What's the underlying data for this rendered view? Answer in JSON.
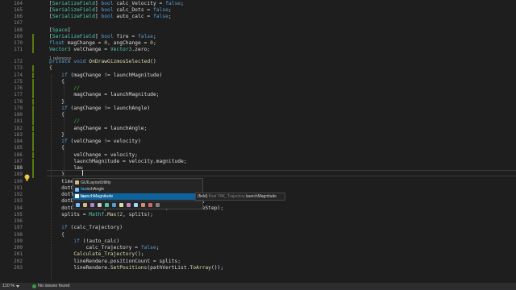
{
  "editor": {
    "lines": [
      {
        "num": "164",
        "mod": false,
        "tokens": [
          [
            "c",
            "p",
            ""
          ],
          [
            "t",
            "p",
            "["
          ],
          [
            "t",
            "t",
            "SerializeField"
          ],
          [
            "t",
            "p",
            "] "
          ],
          [
            "t",
            "k",
            "bool"
          ],
          [
            "t",
            "p",
            " calc_Velocity = "
          ],
          [
            "t",
            "k",
            "false"
          ],
          [
            "t",
            "p",
            ";"
          ]
        ]
      },
      {
        "num": "165",
        "mod": false,
        "tokens": [
          [
            "t",
            "p",
            "["
          ],
          [
            "t",
            "t",
            "SerializeField"
          ],
          [
            "t",
            "p",
            "] "
          ],
          [
            "t",
            "k",
            "bool"
          ],
          [
            "t",
            "p",
            " calc_Dots = "
          ],
          [
            "t",
            "k",
            "false"
          ],
          [
            "t",
            "p",
            ";"
          ]
        ]
      },
      {
        "num": "166",
        "mod": false,
        "tokens": [
          [
            "t",
            "p",
            "["
          ],
          [
            "t",
            "t",
            "SerializeField"
          ],
          [
            "t",
            "p",
            "] "
          ],
          [
            "t",
            "k",
            "bool"
          ],
          [
            "t",
            "p",
            " auto_calc = "
          ],
          [
            "t",
            "k",
            "false"
          ],
          [
            "t",
            "p",
            ";"
          ]
        ]
      },
      {
        "num": "167",
        "mod": false,
        "tokens": []
      },
      {
        "num": "168",
        "mod": false,
        "tokens": [
          [
            "t",
            "p",
            "["
          ],
          [
            "t",
            "t",
            "Space"
          ],
          [
            "t",
            "p",
            "]"
          ]
        ]
      },
      {
        "num": "169",
        "mod": true,
        "tokens": [
          [
            "t",
            "p",
            "["
          ],
          [
            "t",
            "t",
            "SerializeField"
          ],
          [
            "t",
            "p",
            "] "
          ],
          [
            "t",
            "k",
            "bool"
          ],
          [
            "t",
            "p",
            " fire = "
          ],
          [
            "t",
            "k",
            "false"
          ],
          [
            "t",
            "p",
            ";"
          ]
        ]
      },
      {
        "num": "170",
        "mod": true,
        "tokens": [
          [
            "t",
            "k",
            "float"
          ],
          [
            "t",
            "p",
            " magChange = "
          ],
          [
            "t",
            "n",
            "0"
          ],
          [
            "t",
            "p",
            ", angChange = "
          ],
          [
            "t",
            "n",
            "0"
          ],
          [
            "t",
            "p",
            ";"
          ]
        ]
      },
      {
        "num": "171",
        "mod": true,
        "tokens": [
          [
            "t",
            "t",
            "Vector3"
          ],
          [
            "t",
            "p",
            " velChange = "
          ],
          [
            "t",
            "t",
            "Vector3"
          ],
          [
            "t",
            "p",
            ".zero;"
          ]
        ]
      },
      {
        "num": "172",
        "mod": false,
        "tokens": [
          [
            "t",
            "k",
            "private void"
          ],
          [
            "t",
            "p",
            " "
          ],
          [
            "t",
            "m",
            "OnDrawGizmosSelected"
          ],
          [
            "t",
            "p",
            "()"
          ]
        ]
      },
      {
        "num": "173",
        "mod": true,
        "tokens": [
          [
            "t",
            "p",
            "{"
          ]
        ]
      },
      {
        "num": "174",
        "mod": true,
        "tokens": [
          [
            "t",
            "p",
            "    "
          ],
          [
            "t",
            "k",
            "if"
          ],
          [
            "t",
            "p",
            " (magChange != launchMagnitude)"
          ]
        ]
      },
      {
        "num": "175",
        "mod": true,
        "tokens": [
          [
            "t",
            "p",
            "    {"
          ]
        ]
      },
      {
        "num": "176",
        "mod": true,
        "tokens": [
          [
            "t",
            "c",
            "        //"
          ]
        ]
      },
      {
        "num": "177",
        "mod": true,
        "tokens": [
          [
            "t",
            "p",
            "        magChange = launchMagnitude;"
          ]
        ]
      },
      {
        "num": "178",
        "mod": true,
        "tokens": [
          [
            "t",
            "p",
            "    }"
          ]
        ]
      },
      {
        "num": "179",
        "mod": true,
        "tokens": [
          [
            "t",
            "p",
            "    "
          ],
          [
            "t",
            "k",
            "if"
          ],
          [
            "t",
            "p",
            " (angChange != launchAngle)"
          ]
        ]
      },
      {
        "num": "180",
        "mod": true,
        "tokens": [
          [
            "t",
            "p",
            "    {"
          ]
        ]
      },
      {
        "num": "181",
        "mod": true,
        "tokens": [
          [
            "t",
            "c",
            "        //"
          ]
        ]
      },
      {
        "num": "182",
        "mod": true,
        "tokens": [
          [
            "t",
            "p",
            "        angChange = launchAngle;"
          ]
        ]
      },
      {
        "num": "183",
        "mod": true,
        "tokens": [
          [
            "t",
            "p",
            "    }"
          ]
        ]
      },
      {
        "num": "184",
        "mod": true,
        "tokens": [
          [
            "t",
            "p",
            "    "
          ],
          [
            "t",
            "k",
            "if"
          ],
          [
            "t",
            "p",
            " (velChange != velocity)"
          ]
        ]
      },
      {
        "num": "185",
        "mod": true,
        "tokens": [
          [
            "t",
            "p",
            "    {"
          ]
        ]
      },
      {
        "num": "186",
        "mod": true,
        "tokens": [
          [
            "t",
            "p",
            "        velChange = velocity;"
          ]
        ]
      },
      {
        "num": "187",
        "mod": true,
        "tokens": [
          [
            "t",
            "p",
            "        launchMagnitude = velocity.magnitude;"
          ]
        ]
      },
      {
        "num": "188",
        "mod": true,
        "tokens": [
          [
            "t",
            "p",
            "        lau"
          ]
        ]
      },
      {
        "num": "189",
        "mod": true,
        "tokens": [
          [
            "t",
            "p",
            "    }"
          ]
        ]
      },
      {
        "num": "190",
        "mod": false,
        "tokens": [
          [
            "t",
            "p",
            "    time"
          ]
        ]
      },
      {
        "num": "191",
        "mod": false,
        "tokens": [
          [
            "t",
            "p",
            "    dotC"
          ]
        ]
      },
      {
        "num": "192",
        "mod": false,
        "tokens": [
          [
            "t",
            "p",
            "    dotT"
          ]
        ]
      },
      {
        "num": "193",
        "mod": false,
        "tokens": [
          [
            "t",
            "p",
            "    dotDistSpace = "
          ],
          [
            "t",
            "t",
            "Mathf"
          ],
          [
            "t",
            "p",
            "."
          ],
          [
            "t",
            "m",
            "Max"
          ],
          [
            "t",
            "p",
            "("
          ],
          [
            "t",
            "n",
            "0.001f"
          ],
          [
            "t",
            "p",
            ", dotDistSpace);"
          ]
        ]
      },
      {
        "num": "194",
        "mod": false,
        "tokens": [
          [
            "t",
            "p",
            "    dotCalcTimeStep = "
          ],
          [
            "t",
            "t",
            "Mathf"
          ],
          [
            "t",
            "p",
            "."
          ],
          [
            "t",
            "m",
            "Max"
          ],
          [
            "t",
            "p",
            "("
          ],
          [
            "t",
            "n",
            "0.001f"
          ],
          [
            "t",
            "p",
            ", dotCalcTimeStep);"
          ]
        ]
      },
      {
        "num": "195",
        "mod": false,
        "tokens": [
          [
            "t",
            "p",
            "    splits = "
          ],
          [
            "t",
            "t",
            "Mathf"
          ],
          [
            "t",
            "p",
            "."
          ],
          [
            "t",
            "m",
            "Max"
          ],
          [
            "t",
            "p",
            "("
          ],
          [
            "t",
            "n",
            "2"
          ],
          [
            "t",
            "p",
            ", splits);"
          ]
        ]
      },
      {
        "num": "196",
        "mod": false,
        "tokens": []
      },
      {
        "num": "197",
        "mod": false,
        "tokens": [
          [
            "t",
            "p",
            "    "
          ],
          [
            "t",
            "k",
            "if"
          ],
          [
            "t",
            "p",
            " (calc_Trajectory)"
          ]
        ]
      },
      {
        "num": "198",
        "mod": false,
        "tokens": [
          [
            "t",
            "p",
            "    {"
          ]
        ]
      },
      {
        "num": "199",
        "mod": false,
        "tokens": [
          [
            "t",
            "p",
            "        "
          ],
          [
            "t",
            "k",
            "if"
          ],
          [
            "t",
            "p",
            " (!auto_calc)"
          ]
        ]
      },
      {
        "num": "200",
        "mod": false,
        "tokens": [
          [
            "t",
            "p",
            "            calc_Trajectory = "
          ],
          [
            "t",
            "k",
            "false"
          ],
          [
            "t",
            "p",
            ";"
          ]
        ]
      },
      {
        "num": "201",
        "mod": false,
        "tokens": [
          [
            "t",
            "p",
            "        "
          ],
          [
            "t",
            "m",
            "Calculate_Trajectory"
          ],
          [
            "t",
            "p",
            "();"
          ]
        ]
      },
      {
        "num": "202",
        "mod": false,
        "tokens": [
          [
            "t",
            "p",
            "        lineRendere.positionCount = splits;"
          ]
        ]
      },
      {
        "num": "203",
        "mod": false,
        "tokens": [
          [
            "t",
            "p",
            "        lineRendere."
          ],
          [
            "t",
            "m",
            "SetPositions"
          ],
          [
            "t",
            "p",
            "(pathVertList."
          ],
          [
            "t",
            "m",
            "ToArray"
          ],
          [
            "t",
            "p",
            "());"
          ]
        ]
      }
    ],
    "codelens": "1 reference",
    "current_line": "188"
  },
  "completion": {
    "items": [
      {
        "match": "",
        "rest": "GUILayoutUtility",
        "icon_color": "#d7ba7d",
        "selected": false
      },
      {
        "match": "lau",
        "rest": "nchAngle",
        "icon_color": "#75beff",
        "selected": false
      },
      {
        "match": "lau",
        "rest": "nchMagnitude",
        "icon_color": "#75beff",
        "selected": true
      }
    ],
    "filter_icon_colors": [
      "#75beff",
      "#d7ba7d",
      "#b180d7",
      "#cccccc",
      "#4ec9b0",
      "#569cd6",
      "#dcdcaa",
      "#c586c0",
      "#9cdcfe",
      "#ce9178",
      "#d16969",
      "#808080"
    ]
  },
  "tooltip": {
    "kind": "(field) ",
    "type": "float TAK_Trajectory.",
    "name": "launchMagnitude"
  },
  "statusbar": {
    "zoom": "110 %",
    "issues": "No issues found"
  },
  "colors": {
    "p": "#dcdcdc",
    "k": "#569cd6",
    "t": "#4ec9b0",
    "c": "#57a64a",
    "n": "#b5cea8",
    "m": "#dcdcaa"
  }
}
